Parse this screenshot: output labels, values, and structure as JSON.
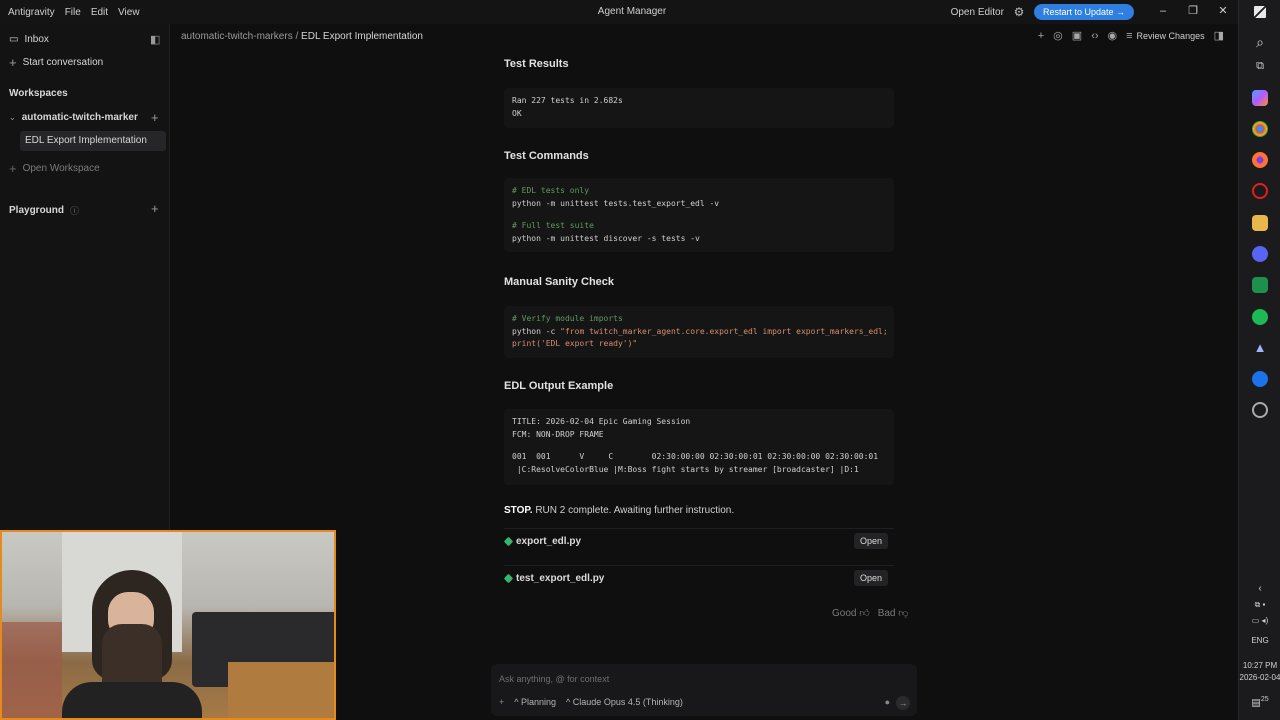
{
  "titlebar": {
    "menu": [
      "Antigravity",
      "File",
      "Edit",
      "View"
    ],
    "title": "Agent Manager",
    "open_editor": "Open Editor",
    "update_button": "Restart to Update →"
  },
  "sidebar": {
    "inbox": "Inbox",
    "start_conversation": "Start conversation",
    "workspaces_heading": "Workspaces",
    "workspace_name": "automatic-twitch-marker",
    "active_conversation": "EDL Export Implementation",
    "open_workspace": "Open Workspace",
    "playground": "Playground"
  },
  "header": {
    "crumb_workspace": "automatic-twitch-markers",
    "crumb_separator": "/",
    "crumb_page": "EDL Export Implementation",
    "review_changes": "Review Changes"
  },
  "content": {
    "test_results_title": "Test Results",
    "test_results_lines": [
      "Ran 227 tests in 2.682s",
      "OK"
    ],
    "test_commands_title": "Test Commands",
    "test_commands": {
      "c1": "# EDL tests only",
      "l1": "python -m unittest tests.test_export_edl -v",
      "c2": "# Full test suite",
      "l2": "python -m unittest discover -s tests -v"
    },
    "sanity_title": "Manual Sanity Check",
    "sanity": {
      "c1": "# Verify module imports",
      "l1_prefix": "python -c ",
      "l1_str": "\"from twitch_marker_agent.core.export_edl import export_markers_edl;",
      "l2_str": "print('EDL export ready')\""
    },
    "edl_title": "EDL Output Example",
    "edl_lines": [
      "TITLE: 2026-02-04 Epic Gaming Session",
      "FCM: NON-DROP FRAME",
      "",
      "001  001      V     C        02:30:00:00 02:30:00:01 02:30:00:00 02:30:00:01",
      " |C:ResolveColorBlue |M:Boss fight starts by streamer [broadcaster] |D:1"
    ],
    "status_bold": "STOP.",
    "status_text": " RUN 2 complete. Awaiting further instruction.",
    "files": [
      {
        "name": "export_edl.py",
        "button": "Open"
      },
      {
        "name": "test_export_edl.py",
        "button": "Open"
      }
    ],
    "feedback_good": "Good",
    "feedback_bad": "Bad"
  },
  "chat": {
    "placeholder": "Ask anything, @ for context",
    "mode": "Planning",
    "model": "Claude Opus 4.5 (Thinking)"
  },
  "taskbar": {
    "lang": "ENG",
    "time": "10:27 PM",
    "date": "2026-02-04",
    "notif_count": "25"
  },
  "colors": {
    "accent": "#2f7fe0",
    "webcam_border": "#e78a1e",
    "file_icon": "#39b56d"
  }
}
